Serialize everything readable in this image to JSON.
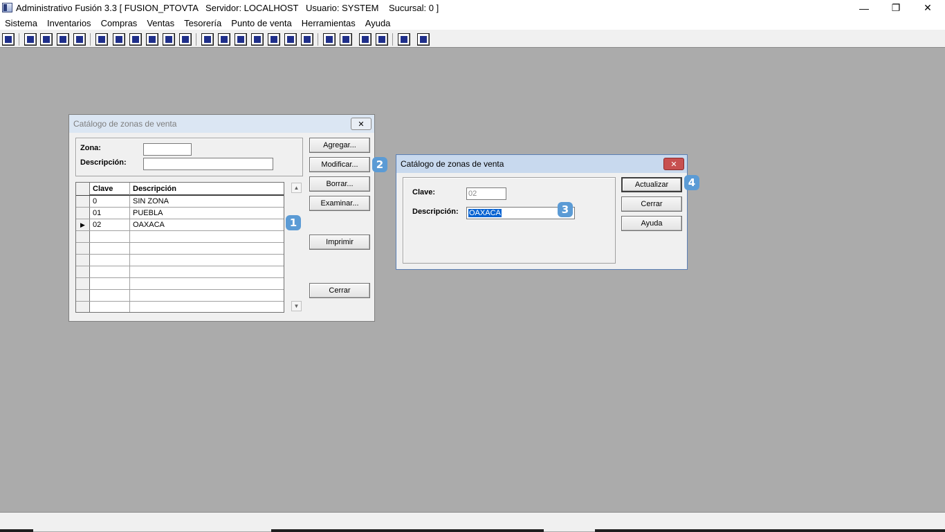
{
  "window": {
    "title": "Administrativo Fusión 3.3 [ FUSION_PTOVTA   Servidor: LOCALHOST   Usuario: SYSTEM    Sucursal: 0 ]",
    "minimize": "—",
    "restore": "❐",
    "close": "✕"
  },
  "menu": [
    "Sistema",
    "Inventarios",
    "Compras",
    "Ventas",
    "Tesorería",
    "Punto de venta",
    "Herramientas",
    "Ayuda"
  ],
  "catalog_dialog": {
    "title": "Catálogo de zonas de venta",
    "close": "✕",
    "zona_label": "Zona:",
    "descripcion_label": "Descripción:",
    "zona_value": "",
    "descripcion_value": "",
    "buttons": {
      "agregar": "Agregar...",
      "modificar": "Modificar...",
      "borrar": "Borrar...",
      "examinar": "Examinar...",
      "imprimir": "Imprimir",
      "cerrar": "Cerrar"
    },
    "grid": {
      "headers": [
        "Clave",
        "Descripción"
      ],
      "rows": [
        {
          "clave": "0",
          "descripcion": "SIN ZONA",
          "marker": ""
        },
        {
          "clave": "01",
          "descripcion": "PUEBLA",
          "marker": ""
        },
        {
          "clave": "02",
          "descripcion": "OAXACA",
          "marker": "▶"
        }
      ]
    },
    "scroll_up": "▲",
    "scroll_down": "▼"
  },
  "edit_dialog": {
    "title": "Catálogo de zonas de venta",
    "close": "✕",
    "clave_label": "Clave:",
    "clave_value": "02",
    "descripcion_label": "Descripción:",
    "descripcion_value": "OAXACA",
    "buttons": {
      "actualizar": "Actualizar",
      "cerrar": "Cerrar",
      "ayuda": "Ayuda"
    }
  },
  "badges": [
    "1",
    "2",
    "3",
    "4"
  ],
  "colors": {
    "desktop": "#ababab",
    "badge": "#5b9bd5",
    "selection": "#0a64d2",
    "close_active": "#c75050"
  }
}
